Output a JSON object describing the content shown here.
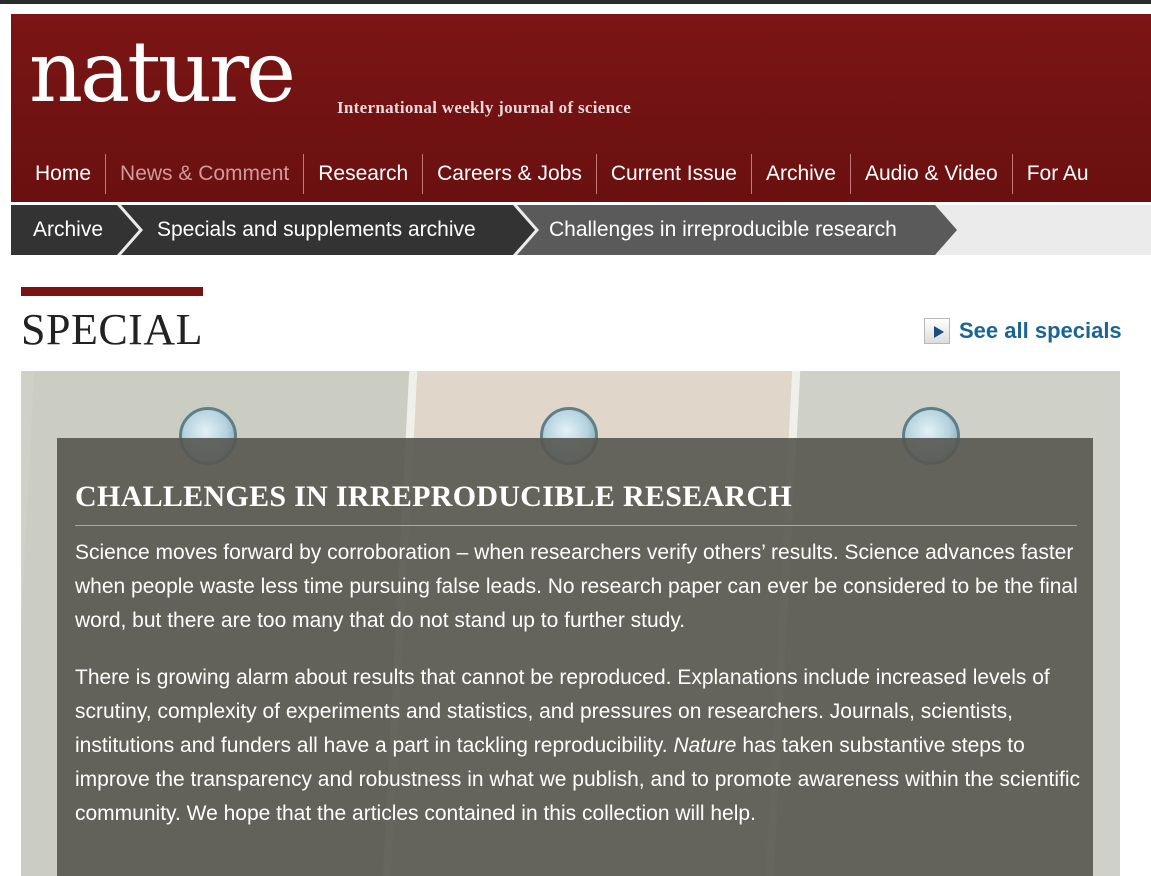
{
  "header": {
    "logo": "nature",
    "tagline": "International weekly journal of science",
    "nav": [
      "Home",
      "News & Comment",
      "Research",
      "Careers & Jobs",
      "Current Issue",
      "Archive",
      "Audio & Video",
      "For Au"
    ]
  },
  "breadcrumb": [
    "Archive",
    "Specials and supplements archive",
    "Challenges in irreproducible research"
  ],
  "special": {
    "label": "SPECIAL",
    "see_all": "See all specials"
  },
  "article": {
    "title": "CHALLENGES IN IRREPRODUCIBLE RESEARCH",
    "para1": "Science moves forward by corroboration – when researchers verify others’ results. Science advances faster when people waste less time pursuing false leads. No research paper can ever be considered to be the final word, but there are too many that do not stand up to further study.",
    "para2_before": "There is growing alarm about results that cannot be reproduced.  Explanations include increased levels of scrutiny, complexity of experiments and statistics, and pressures on researchers. Journals, scientists, institutions and funders all have a part in tackling reproducibility. ",
    "para2_em": "Nature",
    "para2_after": " has taken substantive steps to improve the transparency and robustness in what we publish, and to promote awareness within the scientific community. We hope that the articles contained in this collection will help."
  },
  "colors": {
    "masthead": "#701212",
    "accent_bar": "#7a1414",
    "link": "#1a6596",
    "breadcrumb_dark": "#333333",
    "breadcrumb_current": "#5a5a5a"
  }
}
